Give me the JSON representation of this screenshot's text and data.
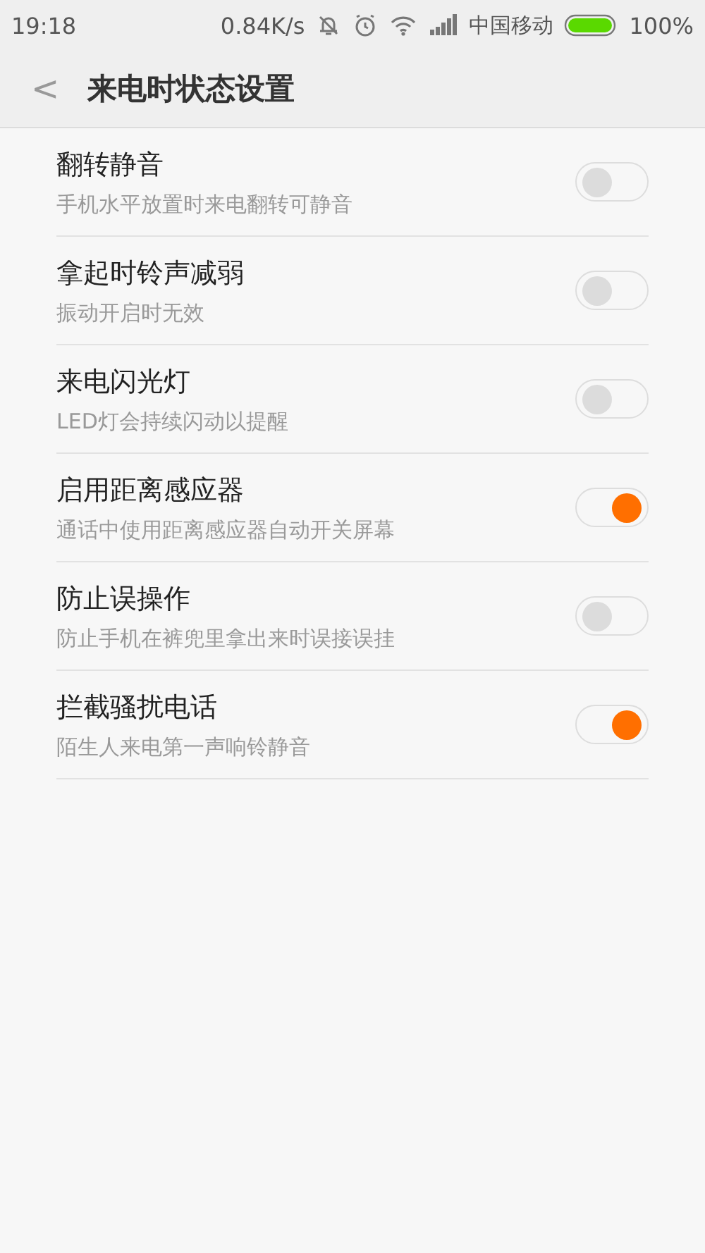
{
  "status_bar": {
    "time": "19:18",
    "speed": "0.84K/s",
    "carrier": "中国移动",
    "battery": "100%"
  },
  "header": {
    "back": "<",
    "title": "来电时状态设置"
  },
  "settings": [
    {
      "title": "翻转静音",
      "subtitle": "手机水平放置时来电翻转可静音",
      "on": false
    },
    {
      "title": "拿起时铃声减弱",
      "subtitle": "振动开启时无效",
      "on": false
    },
    {
      "title": "来电闪光灯",
      "subtitle": "LED灯会持续闪动以提醒",
      "on": false
    },
    {
      "title": "启用距离感应器",
      "subtitle": "通话中使用距离感应器自动开关屏幕",
      "on": true
    },
    {
      "title": "防止误操作",
      "subtitle": "防止手机在裤兜里拿出来时误接误挂",
      "on": false
    },
    {
      "title": "拦截骚扰电话",
      "subtitle": "陌生人来电第一声响铃静音",
      "on": true
    }
  ]
}
